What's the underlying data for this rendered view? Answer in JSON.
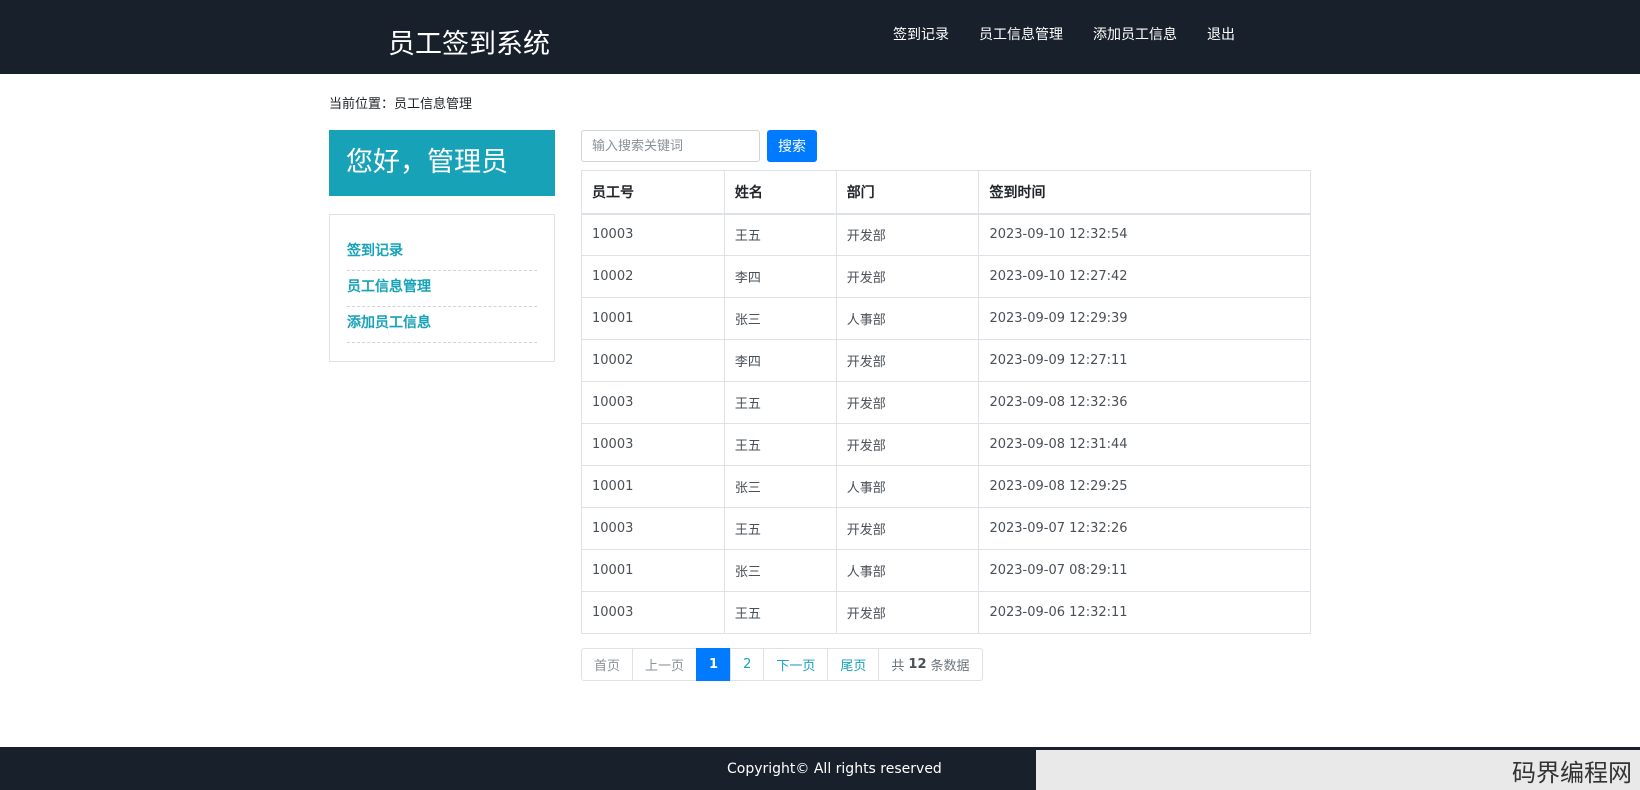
{
  "header": {
    "title": "员工签到系统",
    "nav": [
      "签到记录",
      "员工信息管理",
      "添加员工信息",
      "退出"
    ]
  },
  "breadcrumb": "当前位置：员工信息管理",
  "sidebar": {
    "greeting": "您好，管理员",
    "items": [
      "签到记录",
      "员工信息管理",
      "添加员工信息"
    ]
  },
  "search": {
    "placeholder": "输入搜索关键词",
    "button": "搜索"
  },
  "table": {
    "headers": [
      "员工号",
      "姓名",
      "部门",
      "签到时间"
    ],
    "rows": [
      [
        "10003",
        "王五",
        "开发部",
        "2023-09-10 12:32:54"
      ],
      [
        "10002",
        "李四",
        "开发部",
        "2023-09-10 12:27:42"
      ],
      [
        "10001",
        "张三",
        "人事部",
        "2023-09-09 12:29:39"
      ],
      [
        "10002",
        "李四",
        "开发部",
        "2023-09-09 12:27:11"
      ],
      [
        "10003",
        "王五",
        "开发部",
        "2023-09-08 12:32:36"
      ],
      [
        "10003",
        "王五",
        "开发部",
        "2023-09-08 12:31:44"
      ],
      [
        "10001",
        "张三",
        "人事部",
        "2023-09-08 12:29:25"
      ],
      [
        "10003",
        "王五",
        "开发部",
        "2023-09-07 12:32:26"
      ],
      [
        "10001",
        "张三",
        "人事部",
        "2023-09-07 08:29:11"
      ],
      [
        "10003",
        "王五",
        "开发部",
        "2023-09-06 12:32:11"
      ]
    ]
  },
  "pagination": {
    "first": "首页",
    "prev": "上一页",
    "pages": [
      "1",
      "2"
    ],
    "current": "1",
    "next": "下一页",
    "last": "尾页",
    "total_prefix": "共",
    "total": "12",
    "total_suffix": "条数据"
  },
  "footer": {
    "copyright": "Copyright© All rights reserved",
    "watermark": "码界编程网"
  }
}
